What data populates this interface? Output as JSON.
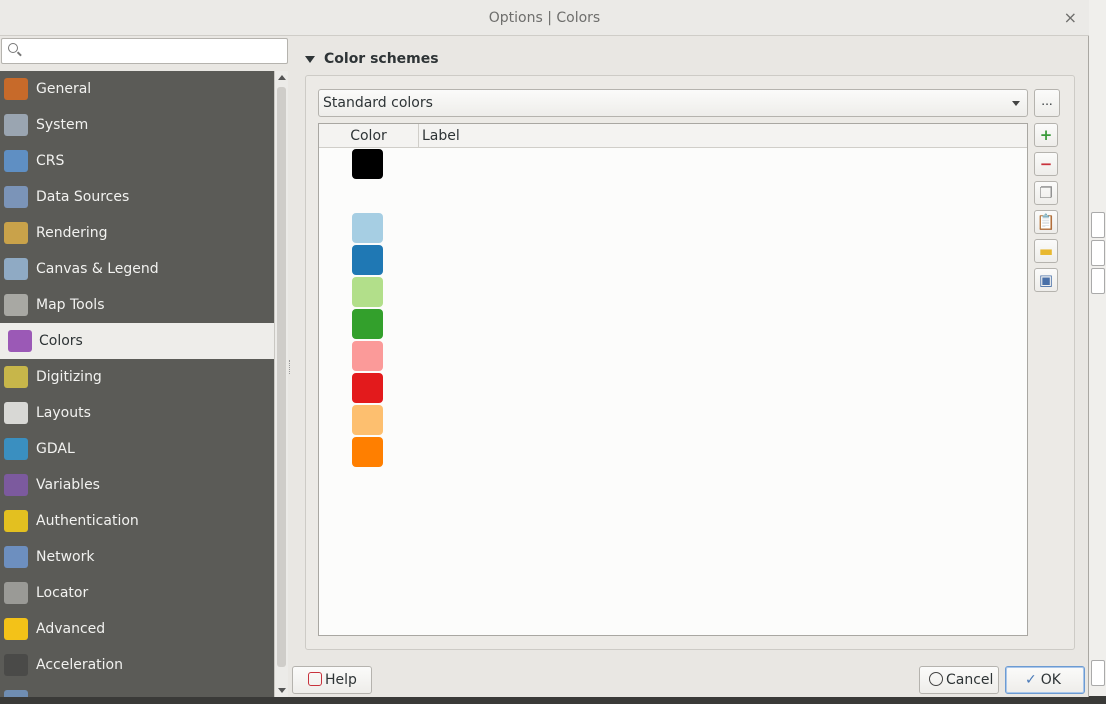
{
  "window": {
    "title": "Options | Colors",
    "close_glyph": "×"
  },
  "search": {
    "placeholder": "",
    "value": ""
  },
  "nav": [
    {
      "label": "General",
      "icon": "general-icon",
      "color": "#c76a2a"
    },
    {
      "label": "System",
      "icon": "system-icon",
      "color": "#9aa5b1"
    },
    {
      "label": "CRS",
      "icon": "crs-icon",
      "color": "#5f8fc3"
    },
    {
      "label": "Data Sources",
      "icon": "data-sources-icon",
      "color": "#7b94b8"
    },
    {
      "label": "Rendering",
      "icon": "rendering-icon",
      "color": "#c9a24a"
    },
    {
      "label": "Canvas & Legend",
      "icon": "canvas-legend-icon",
      "color": "#8faac4"
    },
    {
      "label": "Map Tools",
      "icon": "map-tools-icon",
      "color": "#a8a8a3"
    },
    {
      "label": "Colors",
      "icon": "colors-icon",
      "color": "#9b59b6"
    },
    {
      "label": "Digitizing",
      "icon": "digitizing-icon",
      "color": "#c7b64a"
    },
    {
      "label": "Layouts",
      "icon": "layouts-icon",
      "color": "#d8d8d5"
    },
    {
      "label": "GDAL",
      "icon": "gdal-icon",
      "color": "#3a8fc0"
    },
    {
      "label": "Variables",
      "icon": "variables-icon",
      "color": "#7c5a9e"
    },
    {
      "label": "Authentication",
      "icon": "authentication-icon",
      "color": "#e3c020"
    },
    {
      "label": "Network",
      "icon": "network-icon",
      "color": "#6d8fbf"
    },
    {
      "label": "Locator",
      "icon": "locator-icon",
      "color": "#9a9a96"
    },
    {
      "label": "Advanced",
      "icon": "advanced-icon",
      "color": "#f3c218"
    },
    {
      "label": "Acceleration",
      "icon": "acceleration-icon",
      "color": "#4a4a48"
    },
    {
      "label": "",
      "icon": "more-icon",
      "color": "#6f8db2"
    }
  ],
  "selected_nav": "Colors",
  "colors_section": {
    "header": "Color schemes",
    "scheme": "Standard colors",
    "more_button": "...",
    "columns": [
      "Color",
      "Label"
    ],
    "swatches": [
      "#000000",
      "",
      "#a6cee3",
      "#1f78b4",
      "#b2df8a",
      "#33a02c",
      "#fb9a99",
      "#e31a1c",
      "#fdbf6f",
      "#ff7f00"
    ]
  },
  "side_buttons": [
    {
      "icon": "add-color-icon",
      "glyph": "+",
      "color": "#3a9a3a"
    },
    {
      "icon": "remove-color-icon",
      "glyph": "−",
      "color": "#c8323c"
    },
    {
      "icon": "copy-colors-icon",
      "glyph": "❐",
      "color": "#8a8a8a"
    },
    {
      "icon": "paste-colors-icon",
      "glyph": "📋",
      "color": "#c9a24a"
    },
    {
      "icon": "import-colors-icon",
      "glyph": "▬",
      "color": "#e8b830"
    },
    {
      "icon": "export-colors-icon",
      "glyph": "▣",
      "color": "#4a70a8"
    }
  ],
  "buttons": {
    "help": "Help",
    "cancel": "Cancel",
    "ok": "OK"
  }
}
